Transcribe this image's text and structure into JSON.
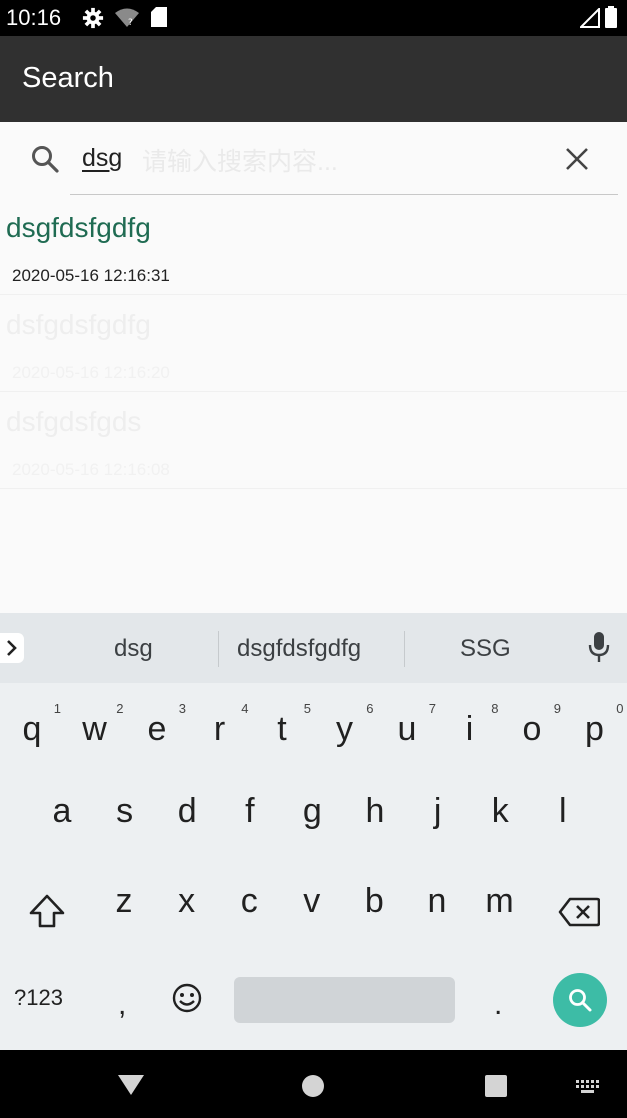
{
  "status_bar": {
    "time": "10:16"
  },
  "app_bar": {
    "title": "Search"
  },
  "search": {
    "value": "dsg",
    "hint": "请输入搜索内容..."
  },
  "results": [
    {
      "title": "dsgfdsfgdfg",
      "date": "2020-05-16 12:16:31",
      "faded": false
    },
    {
      "title": "dsfgdsfgdfg",
      "date": "2020-05-16 12:16:20",
      "faded": true
    },
    {
      "title": "dsfgdsfgds",
      "date": "2020-05-16 12:16:08",
      "faded": true
    }
  ],
  "keyboard": {
    "suggestions": [
      "dsg",
      "dsgfdsfgdfg",
      "SSG"
    ],
    "row1": [
      {
        "c": "q",
        "h": "1"
      },
      {
        "c": "w",
        "h": "2"
      },
      {
        "c": "e",
        "h": "3"
      },
      {
        "c": "r",
        "h": "4"
      },
      {
        "c": "t",
        "h": "5"
      },
      {
        "c": "y",
        "h": "6"
      },
      {
        "c": "u",
        "h": "7"
      },
      {
        "c": "i",
        "h": "8"
      },
      {
        "c": "o",
        "h": "9"
      },
      {
        "c": "p",
        "h": "0"
      }
    ],
    "row2": [
      "a",
      "s",
      "d",
      "f",
      "g",
      "h",
      "j",
      "k",
      "l"
    ],
    "row3": [
      "z",
      "x",
      "c",
      "v",
      "b",
      "n",
      "m"
    ],
    "symbols_label": "?123",
    "comma": ",",
    "period": "."
  },
  "colors": {
    "accent": "#3dbca6",
    "result_title": "#1f6b52",
    "app_bar": "#303030"
  },
  "icons": [
    "settings-icon",
    "wifi-icon",
    "sd-card-icon",
    "signal-icon",
    "battery-icon",
    "search-icon",
    "close-icon",
    "chevron-right-icon",
    "mic-icon",
    "shift-icon",
    "backspace-icon",
    "emoji-icon",
    "back-icon",
    "home-icon",
    "recents-icon",
    "keyboard-switch-icon"
  ]
}
